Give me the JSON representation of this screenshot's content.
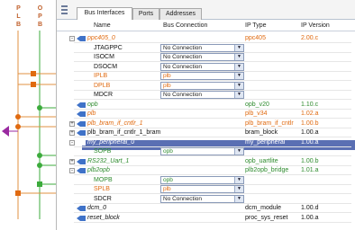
{
  "bus_panel": {
    "headers": [
      "P",
      "O",
      "L",
      "P",
      "B",
      "B"
    ]
  },
  "tabs": [
    "Bus Interfaces",
    "Ports",
    "Addresses"
  ],
  "columns": {
    "name": "Name",
    "bus_connection": "Bus Connection",
    "ip_type": "IP Type",
    "ip_version": "IP Version"
  },
  "rows": [
    {
      "name": "ppc405_0",
      "conn": "",
      "ip": "ppc405",
      "ver": "2.00.c",
      "style": "orange",
      "indent": 1,
      "exp": "-"
    },
    {
      "name": "JTAGPPC",
      "conn": "No Connection",
      "ip": "",
      "ver": "",
      "style": "black",
      "indent": 2
    },
    {
      "name": "ISOCM",
      "conn": "No Connection",
      "ip": "",
      "ver": "",
      "style": "black",
      "indent": 2
    },
    {
      "name": "DSOCM",
      "conn": "No Connection",
      "ip": "",
      "ver": "",
      "style": "black",
      "indent": 2
    },
    {
      "name": "IPLB",
      "conn": "plb",
      "ip": "",
      "ver": "",
      "style": "orange-up",
      "indent": 2
    },
    {
      "name": "DPLB",
      "conn": "plb",
      "ip": "",
      "ver": "",
      "style": "orange-up",
      "indent": 2
    },
    {
      "name": "MDCR",
      "conn": "No Connection",
      "ip": "",
      "ver": "",
      "style": "black",
      "indent": 2
    },
    {
      "name": "opb",
      "conn": "",
      "ip": "opb_v20",
      "ver": "1.10.c",
      "style": "green",
      "indent": 1
    },
    {
      "name": "plb",
      "conn": "",
      "ip": "plb_v34",
      "ver": "1.02.a",
      "style": "orange",
      "indent": 1
    },
    {
      "name": "plb_bram_if_cntlr_1",
      "conn": "",
      "ip": "plb_bram_if_cntlr",
      "ver": "1.00.b",
      "style": "orange",
      "indent": 1,
      "exp": "+"
    },
    {
      "name": "plb_bram_if_cntlr_1_bram",
      "conn": "",
      "ip": "bram_block",
      "ver": "1.00.a",
      "style": "black",
      "indent": 1,
      "exp": "+"
    },
    {
      "name": "my_peripheral_0",
      "conn": "",
      "ip": "my_peripheral",
      "ver": "1.00.a",
      "style": "selected",
      "indent": 1,
      "exp": "-"
    },
    {
      "name": "SOPB",
      "conn": "opb",
      "ip": "",
      "ver": "",
      "style": "green-up",
      "indent": 2
    },
    {
      "name": "RS232_Uart_1",
      "conn": "",
      "ip": "opb_uartlite",
      "ver": "1.00.b",
      "style": "green",
      "indent": 1,
      "exp": "+"
    },
    {
      "name": "plb2opb",
      "conn": "",
      "ip": "plb2opb_bridge",
      "ver": "1.01.a",
      "style": "green",
      "indent": 1,
      "exp": "-"
    },
    {
      "name": "MOPB",
      "conn": "opb",
      "ip": "",
      "ver": "",
      "style": "green-up",
      "indent": 2
    },
    {
      "name": "SPLB",
      "conn": "plb",
      "ip": "",
      "ver": "",
      "style": "orange-up",
      "indent": 2
    },
    {
      "name": "SDCR",
      "conn": "No Connection",
      "ip": "",
      "ver": "",
      "style": "black",
      "indent": 2
    },
    {
      "name": "dcm_0",
      "conn": "",
      "ip": "dcm_module",
      "ver": "1.00.d",
      "style": "black-it",
      "indent": 1
    },
    {
      "name": "reset_block",
      "conn": "",
      "ip": "proc_sys_reset",
      "ver": "1.00.a",
      "style": "black-it",
      "indent": 1
    }
  ],
  "colors": {
    "plb": "#e06a10",
    "opb": "#2e8b2e",
    "selection": "#5a6fb3",
    "bus_line_orange": "#e09040",
    "bus_line_green": "#3cab3c"
  },
  "icons": {
    "dropdown": "▼",
    "expand": "+",
    "collapse": "-"
  }
}
